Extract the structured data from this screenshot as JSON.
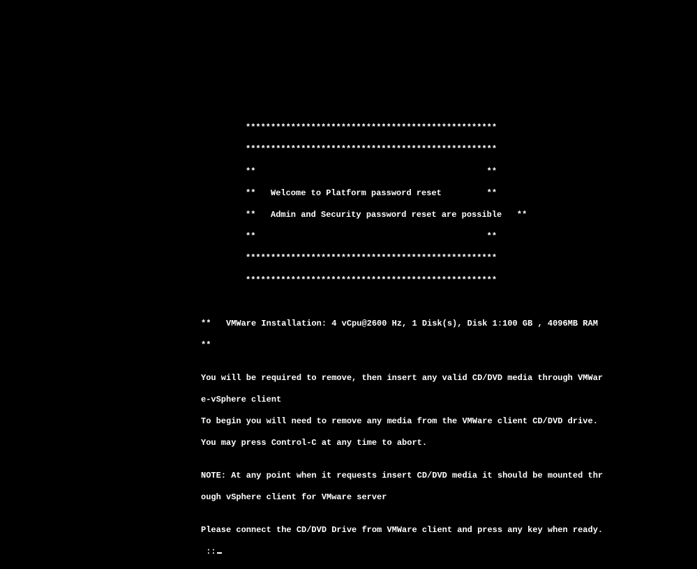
{
  "banner": {
    "border_full": "**************************************************",
    "border_empty": "**                                              **",
    "line1": "**   Welcome to Platform password reset         **",
    "line2": "**   Admin and Security password reset are possible   **"
  },
  "info": {
    "vmware_install": "**   VMWare Installation: 4 vCpu@2600 Hz, 1 Disk(s), Disk 1:100 GB , 4096MB RAM",
    "asterisks": "**"
  },
  "body": {
    "line1": "You will be required to remove, then insert any valid CD/DVD media through VMWar",
    "line2": "e-vSphere client",
    "line3": "To begin you will need to remove any media from the VMWare client CD/DVD drive.",
    "line4": "You may press Control-C at any time to abort.",
    "blank": "",
    "note1": "NOTE: At any point when it requests insert CD/DVD media it should be mounted thr",
    "note2": "ough vSphere client for VMware server",
    "prompt": "Please connect the CD/DVD Drive from VMWare client and press any key when ready.",
    "dots": " ::"
  }
}
